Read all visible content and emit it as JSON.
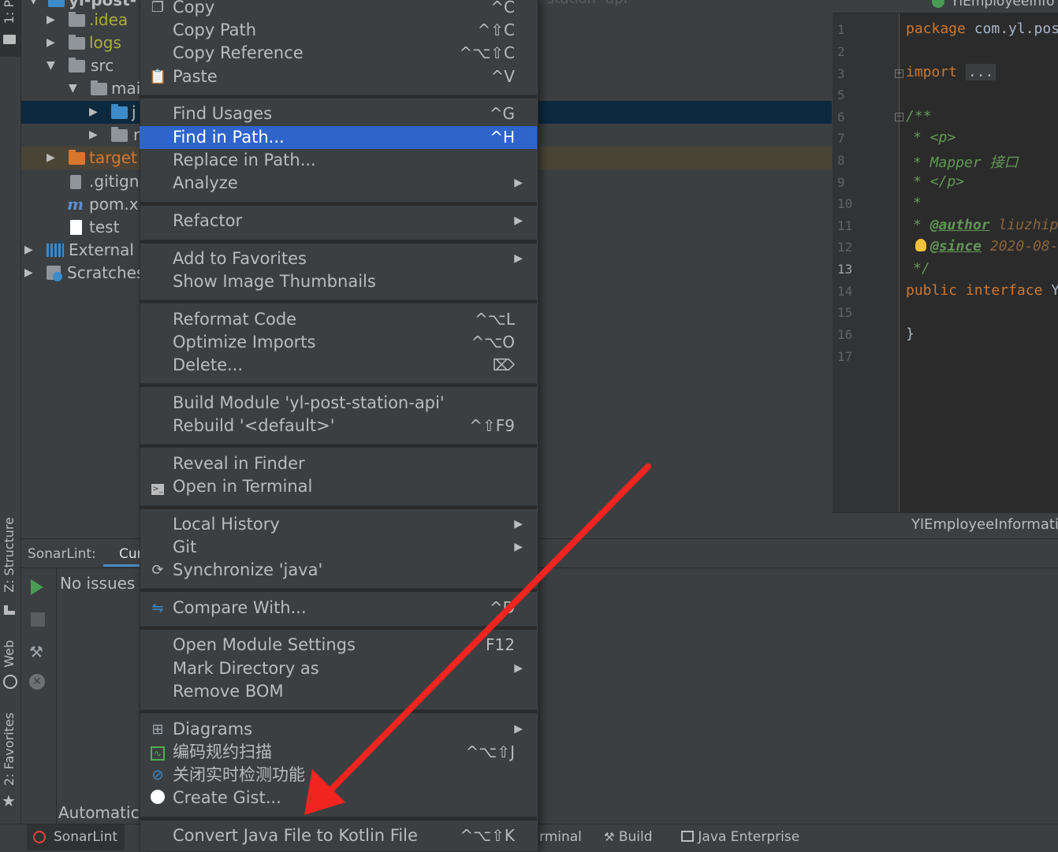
{
  "colors": {
    "menu_bg": "#3c3f41",
    "highlight": "#2f65ca",
    "editor_bg": "#2b2b2b",
    "keyword": "#cc7832",
    "comment": "#629755",
    "arrow": "#f2241f"
  },
  "left_strip": {
    "project_tab": "1: P",
    "structure_tab": "Z: Structure",
    "web_tab": "Web",
    "favorites_tab": "2: Favorites"
  },
  "project_tree": {
    "root_label": "yl-post-",
    "items": [
      {
        "label": ".idea",
        "icon": "folder-icon"
      },
      {
        "label": "logs",
        "icon": "folder-icon"
      },
      {
        "label": "src",
        "icon": "folder-icon"
      },
      {
        "label": "mai",
        "icon": "folder-icon"
      },
      {
        "label": "j",
        "icon": "source-folder-icon"
      },
      {
        "label": "r",
        "icon": "resources-folder-icon"
      },
      {
        "label": "target",
        "icon": "folder-icon"
      },
      {
        "label": ".gitign",
        "icon": "gitignore-file-icon"
      },
      {
        "label": "pom.x",
        "icon": "maven-icon"
      },
      {
        "label": "test",
        "icon": "file-icon"
      },
      {
        "label": "External L",
        "icon": "library-icon"
      },
      {
        "label": "Scratches",
        "icon": "scratches-icon"
      }
    ]
  },
  "editor_header": {
    "faded_title": "station- api"
  },
  "editor": {
    "tab_title": "YlEmployeeInfo",
    "line_numbers": [
      "1",
      "2",
      "3",
      "5",
      "6",
      "7",
      "8",
      "9",
      "10",
      "11",
      "12",
      "13",
      "14",
      "15",
      "16",
      "17"
    ],
    "lines": {
      "package_kw": "package",
      "package_name": "com.yl.pos",
      "import_kw": "import",
      "import_fold": "...",
      "doc_start": "/**",
      "doc_p_open": "* <p>",
      "doc_mapper": "*  Mapper 接口",
      "doc_p_close": "* </p>",
      "doc_star": "*",
      "doc_author_tag": "@author",
      "doc_author_val": "liuzhip",
      "doc_since_tag": "@since",
      "doc_since_val": "2020-08-",
      "doc_end": "*/",
      "public_kw": "public",
      "interface_kw": "interface",
      "iface_name": "Yl",
      "close_brace": "}"
    },
    "breadcrumb": "YlEmployeeInformatio"
  },
  "sonar_panel": {
    "tab1": "SonarLint:",
    "tab2": "Cur",
    "no_issues": "No issues",
    "automatic": "Automatic"
  },
  "status_bar": {
    "sonarlint": "SonarLint",
    "terminal": "rminal",
    "build": "Build",
    "java_enterprise": "Java Enterprise"
  },
  "context_menu": {
    "copy": {
      "label": "Copy",
      "shortcut": "^C"
    },
    "copy_path": {
      "label": "Copy Path",
      "shortcut": "^⇧C"
    },
    "copy_reference": {
      "label": "Copy Reference",
      "shortcut": "^⌥⇧C"
    },
    "paste": {
      "label": "Paste",
      "shortcut": "^V"
    },
    "find_usages": {
      "label": "Find Usages",
      "shortcut": "^G"
    },
    "find_in_path": {
      "label": "Find in Path...",
      "shortcut": "^H"
    },
    "replace_in_path": {
      "label": "Replace in Path..."
    },
    "analyze": {
      "label": "Analyze"
    },
    "refactor": {
      "label": "Refactor"
    },
    "add_to_favorites": {
      "label": "Add to Favorites"
    },
    "show_image_thumbnails": {
      "label": "Show Image Thumbnails"
    },
    "reformat_code": {
      "label": "Reformat Code",
      "shortcut": "^⌥L"
    },
    "optimize_imports": {
      "label": "Optimize Imports",
      "shortcut": "^⌥O"
    },
    "delete": {
      "label": "Delete...",
      "shortcut": "⌦"
    },
    "build_module": {
      "label": "Build Module 'yl-post-station-api'"
    },
    "rebuild": {
      "label": "Rebuild '<default>'",
      "shortcut": "^⇧F9"
    },
    "reveal_in_finder": {
      "label": "Reveal in Finder"
    },
    "open_in_terminal": {
      "label": "Open in Terminal"
    },
    "local_history": {
      "label": "Local History"
    },
    "git": {
      "label": "Git"
    },
    "synchronize": {
      "label": "Synchronize 'java'"
    },
    "compare_with": {
      "label": "Compare With...",
      "shortcut": "^D"
    },
    "open_module_settings": {
      "label": "Open Module Settings",
      "shortcut": "F12"
    },
    "mark_directory_as": {
      "label": "Mark Directory as"
    },
    "remove_bom": {
      "label": "Remove BOM"
    },
    "diagrams": {
      "label": "Diagrams"
    },
    "code_scan": {
      "label": "编码规约扫描",
      "shortcut": "^⌥⇧J"
    },
    "close_realtime": {
      "label": "关闭实时检测功能"
    },
    "create_gist": {
      "label": "Create Gist..."
    },
    "convert_kotlin": {
      "label": "Convert Java File to Kotlin File",
      "shortcut": "^⌥⇧K"
    }
  }
}
